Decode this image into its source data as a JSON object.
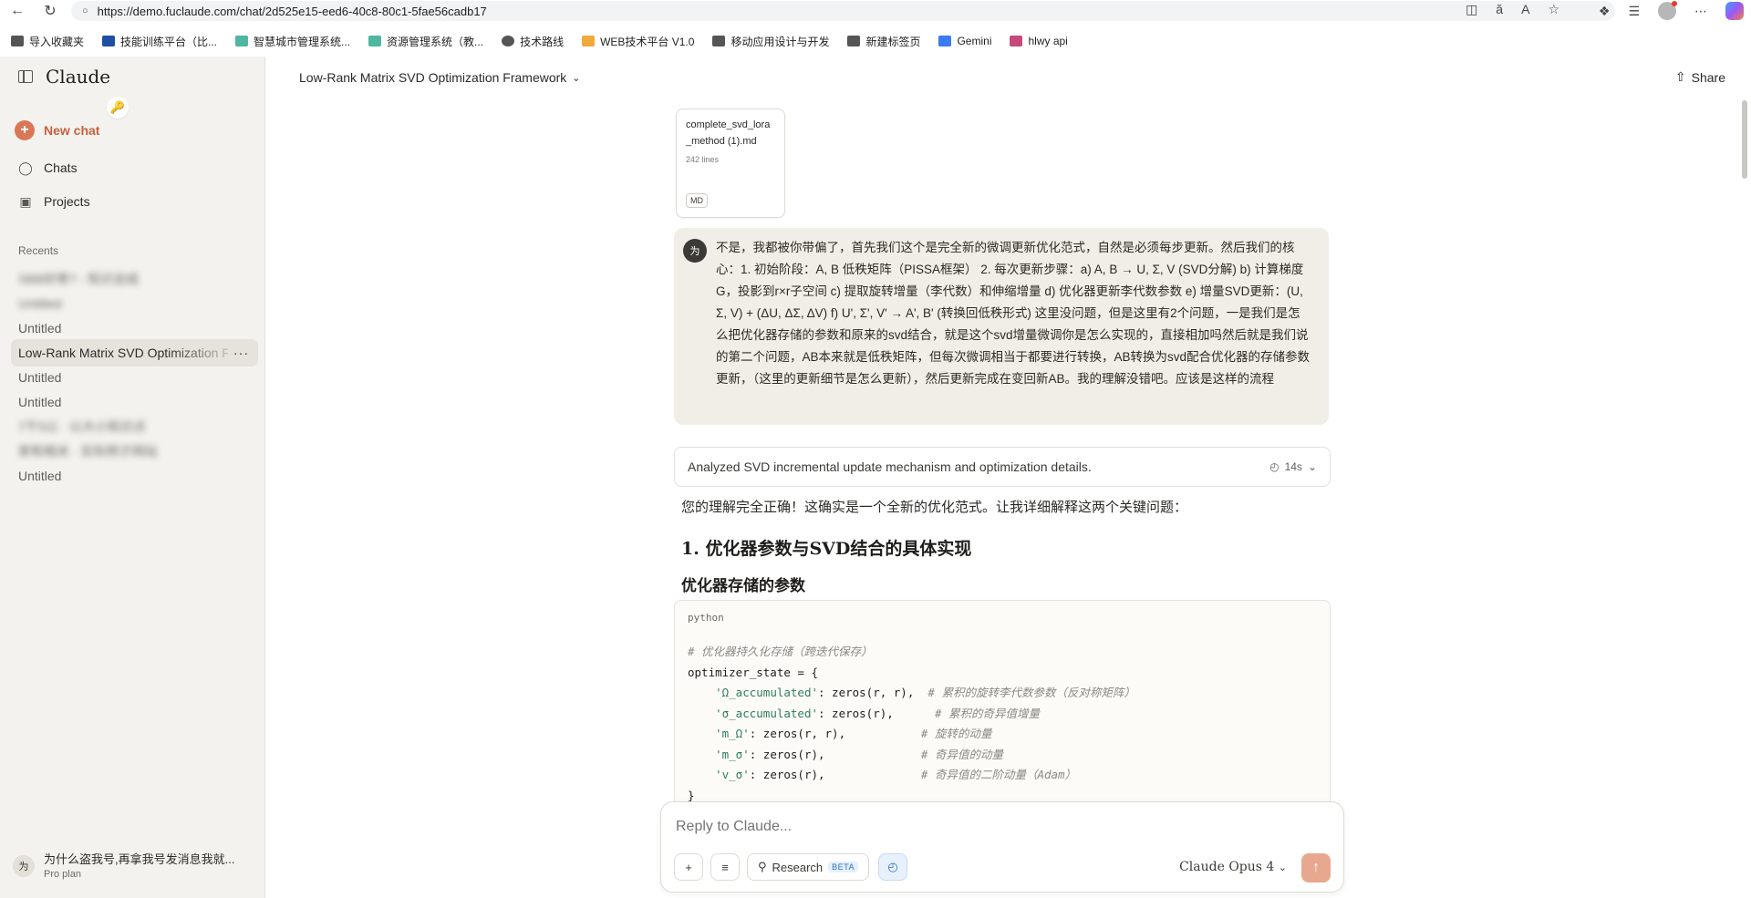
{
  "browser": {
    "url": "https://demo.fuclaude.com/chat/2d525e15-eed6-40c8-80c1-5fae56cadb17",
    "bookmarks": [
      {
        "label": "导入收藏夹",
        "icon": "import-icon",
        "color": "#555555"
      },
      {
        "label": "技能训练平台（比...",
        "icon": "site-icon",
        "color": "#1e4fa3"
      },
      {
        "label": "智慧城市管理系统...",
        "icon": "site-icon",
        "color": "#4fb7a0"
      },
      {
        "label": "资源管理系统（教...",
        "icon": "site-icon",
        "color": "#4fb7a0"
      },
      {
        "label": "技术路线",
        "icon": "globe-icon",
        "color": "#555555"
      },
      {
        "label": "WEB技术平台 V1.0",
        "icon": "site-icon",
        "color": "#f2a93b"
      },
      {
        "label": "移动应用设计与开发",
        "icon": "folder-icon",
        "color": "#555555"
      },
      {
        "label": "新建标签页",
        "icon": "tab-icon",
        "color": "#555555"
      },
      {
        "label": "Gemini",
        "icon": "gemini-icon",
        "color": "#3c7af0"
      },
      {
        "label": "hlwy api",
        "icon": "site-icon",
        "color": "#c54a7a"
      }
    ]
  },
  "sidebar": {
    "app_name": "Claude",
    "new_chat": "New chat",
    "nav": [
      {
        "label": "Chats",
        "icon": "chat-bubble-icon"
      },
      {
        "label": "Projects",
        "icon": "folder-icon"
      }
    ],
    "recents_label": "Recents",
    "recents": [
      {
        "label": "SBB好奇? - 知识总结",
        "blurred": true
      },
      {
        "label": "Untitled",
        "blurred": true
      },
      {
        "label": "Untitled",
        "blurred": false
      },
      {
        "label": "Low-Rank Matrix SVD Optimization Framework",
        "blurred": false,
        "active": true
      },
      {
        "label": "Untitled",
        "blurred": false
      },
      {
        "label": "Untitled",
        "blurred": false
      },
      {
        "label": "7千5以 · 以大小知识点",
        "blurred": true
      },
      {
        "label": "家和相关 · 实际例子网站",
        "blurred": true
      },
      {
        "label": "Untitled",
        "blurred": false
      }
    ],
    "more_glyph": "···",
    "user": {
      "avatar": "为",
      "name": "为什么盗我号,再拿我号发消息我就...",
      "plan": "Pro plan"
    }
  },
  "header": {
    "chat_title": "Low-Rank Matrix SVD Optimization Framework",
    "share": "Share"
  },
  "attachment": {
    "name": "complete_svd_lora_method (1).md",
    "lines": "242 lines",
    "type": "MD"
  },
  "user_message": {
    "avatar": "为",
    "text": "不是，我都被你带偏了，首先我们这个是完全新的微调更新优化范式，自然是必须每步更新。然后我们的核心：1. 初始阶段：A, B 低秩矩阵（PISSA框架） 2. 每次更新步骤：a) A, B → U, Σ, V (SVD分解) b) 计算梯度G，投影到r×r子空间 c) 提取旋转增量（李代数）和伸缩增量 d) 优化器更新李代数参数 e) 增量SVD更新：(U, Σ, V) + (ΔU, ΔΣ, ΔV) f) U', Σ', V' → A', B' (转换回低秩形式) 这里没问题，但是这里有2个问题，一是我们是怎么把优化器存储的参数和原来的svd结合，就是这个svd增量微调你是怎么实现的，直接相加吗然后就是我们说的第二个问题，AB本来就是低秩矩阵，但每次微调相当于都要进行转换，AB转换为svd配合优化器的存储参数更新，（这里的更新细节是怎么更新），然后更新完成在变回新AB。我的理解没错吧。应该是这样的流程"
  },
  "assistant": {
    "thinking_summary": "Analyzed SVD incremental update mechanism and optimization details.",
    "thinking_time": "14s",
    "intro": "您的理解完全正确！这确实是一个全新的优化范式。让我详细解释这两个关键问题：",
    "heading1": "1. 优化器参数与SVD结合的具体实现",
    "heading2": "优化器存储的参数",
    "code_lang": "python",
    "code_lines": [
      {
        "comment": "# 优化器持久化存储（跨迭代保存）"
      },
      {
        "plain": "optimizer_state = {"
      },
      {
        "key": "'Ω_accumulated'",
        "value": ": zeros(r, r),  ",
        "comment": "# 累积的旋转李代数参数（反对称矩阵）"
      },
      {
        "key": "'σ_accumulated'",
        "value": ": zeros(r),      ",
        "comment": "# 累积的奇异值增量"
      },
      {
        "key": "'m_Ω'",
        "value": ": zeros(r, r),           ",
        "comment": "# 旋转的动量"
      },
      {
        "key": "'m_σ'",
        "value": ": zeros(r),              ",
        "comment": "# 奇异值的动量"
      },
      {
        "key": "'v_σ'",
        "value": ": zeros(r),              ",
        "comment": "# 奇异值的二阶动量（Adam）"
      },
      {
        "plain": "}"
      }
    ]
  },
  "composer": {
    "placeholder": "Reply to Claude...",
    "research_label": "Research",
    "beta_label": "BETA",
    "model": "Claude Opus 4"
  },
  "colors": {
    "accent": "#d97757",
    "sidebar_bg": "#f3f2ee",
    "user_bubble": "#f0eee6"
  }
}
